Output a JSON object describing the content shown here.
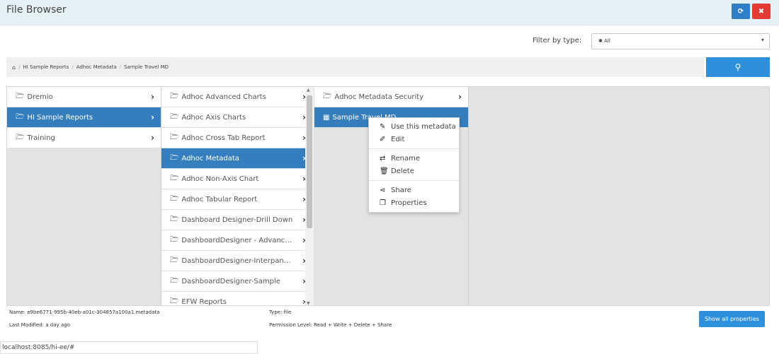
{
  "header": {
    "title": "File Browser",
    "refresh_glyph": "⟳",
    "close_glyph": "✖"
  },
  "filter": {
    "label": "Filter by type:",
    "value": "✱ All",
    "caret": "▾"
  },
  "breadcrumb": {
    "home_glyph": "⌂",
    "items": [
      "HI Sample Reports",
      "Adhoc Metadata",
      "Sample Travel MD"
    ]
  },
  "search": {
    "glyph": "⚲"
  },
  "column1": [
    {
      "label": "Dremio"
    },
    {
      "label": "HI Sample Reports"
    },
    {
      "label": "Training"
    }
  ],
  "column2": [
    {
      "label": "Adhoc Advanced Charts"
    },
    {
      "label": "Adhoc Axis Charts"
    },
    {
      "label": "Adhoc Cross Tab Report"
    },
    {
      "label": "Adhoc Metadata"
    },
    {
      "label": "Adhoc Non-Axis Chart"
    },
    {
      "label": "Adhoc Tabular Report"
    },
    {
      "label": "Dashboard Designer-Drill Down"
    },
    {
      "label": "DashboardDesigner - Advanced M..."
    },
    {
      "label": "DashboardDesigner-InterpanelCo..."
    },
    {
      "label": "DashboardDesigner-Sample"
    },
    {
      "label": "EFW Reports"
    }
  ],
  "column3": [
    {
      "label": "Adhoc Metadata Security"
    },
    {
      "label": "Sample Travel MD"
    }
  ],
  "context_menu": {
    "use": "Use this metadata",
    "edit": "Edit",
    "rename": "Rename",
    "delete": "Delete",
    "share": "Share",
    "properties": "Properties"
  },
  "info": {
    "name": "Name: e9be6771-995b-40eb-a01c-304857a100a1.metadata",
    "type": "Type: file",
    "modified": "Last Modified: a day ago",
    "permission": "Permission Level: Read + Write + Delete + Share"
  },
  "show_all_label": "Show all properties",
  "status_url": "localhost:8085/hi-ee/#",
  "icons": {
    "folder": "🗁",
    "table": "▦",
    "chevron": "›",
    "pencil": "✎",
    "edit": "✐",
    "rename": "⇄",
    "delete": "🗑",
    "share": "⋖",
    "properties": "❐"
  }
}
